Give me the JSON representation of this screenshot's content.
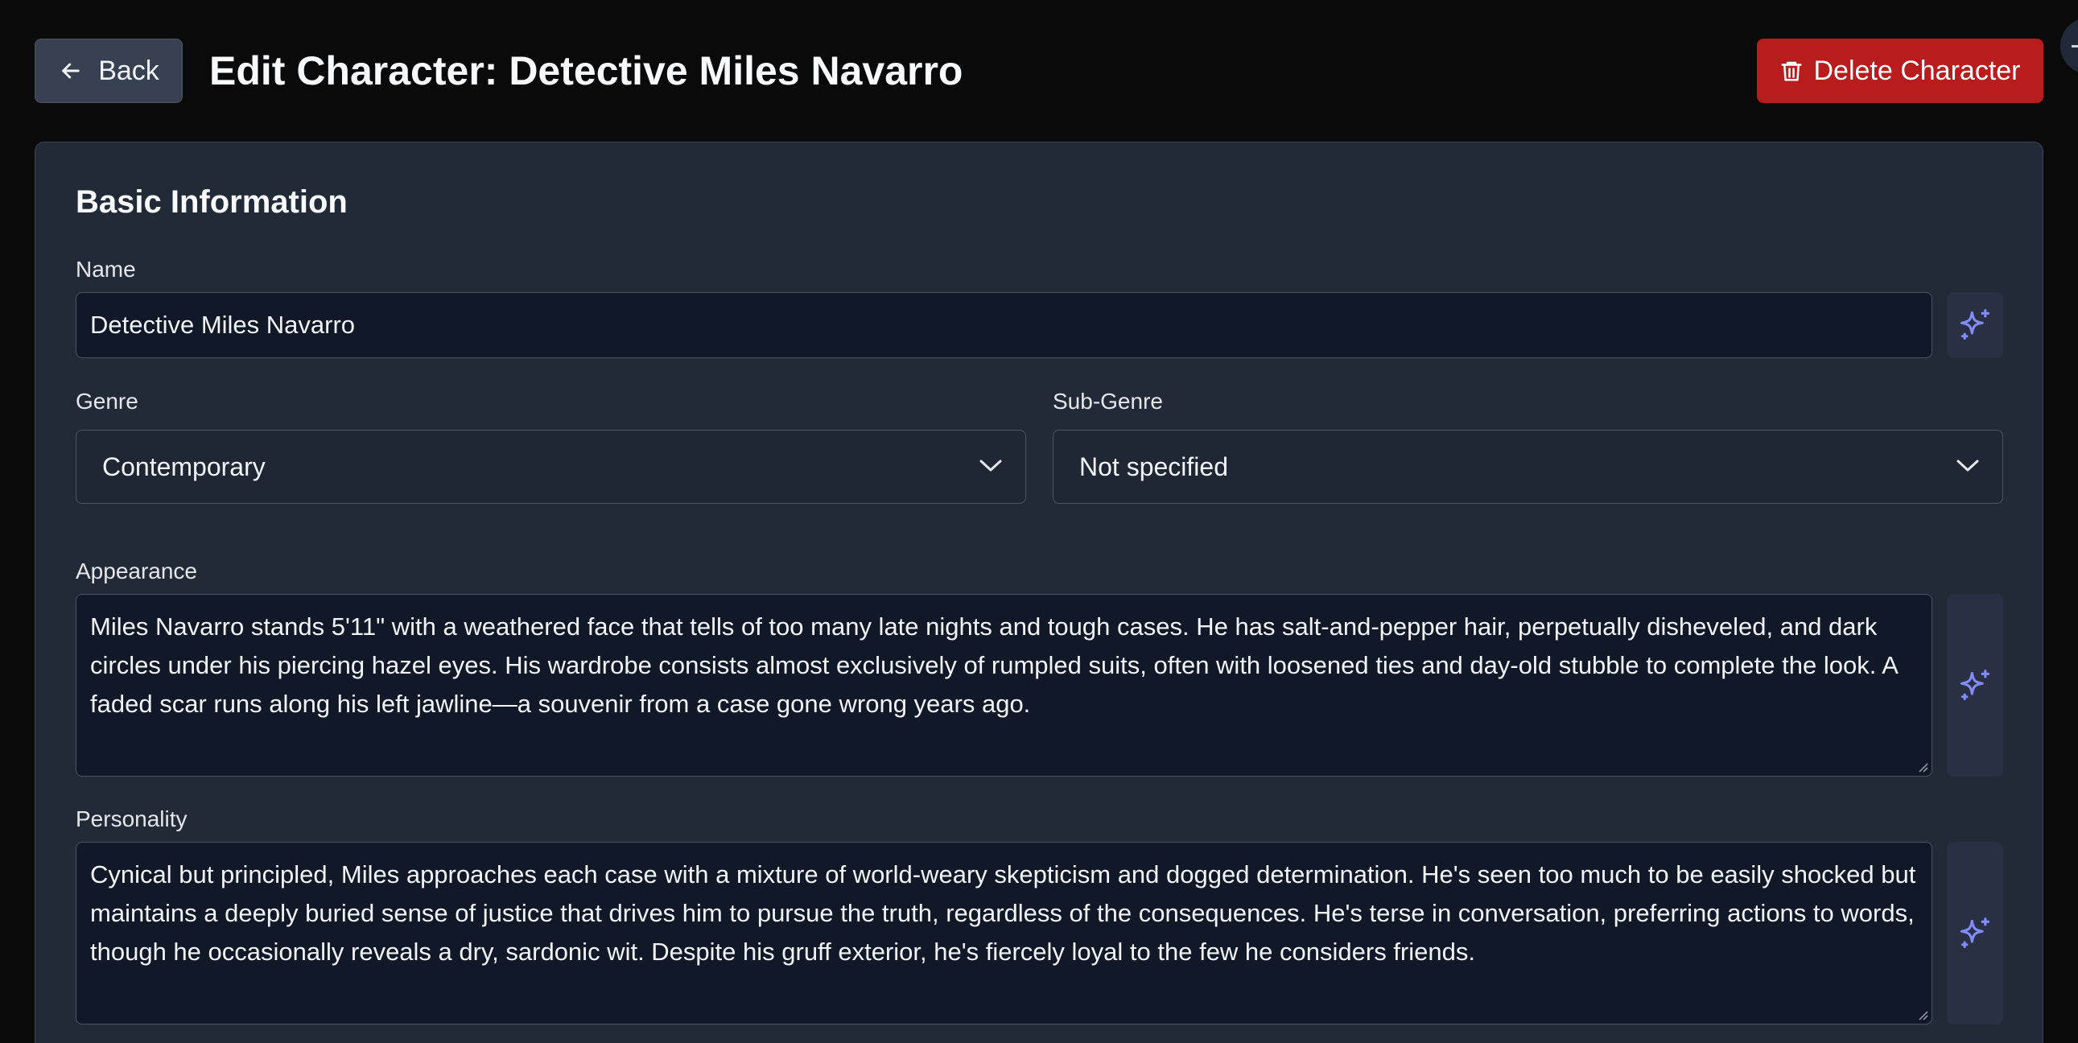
{
  "header": {
    "back_label": "Back",
    "title": "Edit Character: Detective Miles Navarro",
    "delete_label": "Delete Character"
  },
  "colors": {
    "accent": "#818cf8",
    "danger": "#b91c1c",
    "card_bg": "#222a38",
    "input_bg": "#111827"
  },
  "icons": {
    "back": "arrow-left-icon",
    "delete": "trash-icon",
    "generate": "sparkles-icon",
    "dropdown": "chevron-down-icon"
  },
  "basic_info": {
    "title": "Basic Information",
    "name": {
      "label": "Name",
      "value": "Detective Miles Navarro"
    },
    "genre": {
      "label": "Genre",
      "value": "Contemporary"
    },
    "sub_genre": {
      "label": "Sub-Genre",
      "value": "Not specified"
    },
    "appearance": {
      "label": "Appearance",
      "value": "Miles Navarro stands 5'11\" with a weathered face that tells of too many late nights and tough cases. He has salt-and-pepper hair, perpetually disheveled, and dark circles under his piercing hazel eyes. His wardrobe consists almost exclusively of rumpled suits, often with loosened ties and day-old stubble to complete the look. A faded scar runs along his left jawline—a souvenir from a case gone wrong years ago."
    },
    "personality": {
      "label": "Personality",
      "value": "Cynical but principled, Miles approaches each case with a mixture of world-weary skepticism and dogged determination. He's seen too much to be easily shocked but maintains a deeply buried sense of justice that drives him to pursue the truth, regardless of the consequences. He's terse in conversation, preferring actions to words, though he occasionally reveals a dry, sardonic wit. Despite his gruff exterior, he's fiercely loyal to the few he considers friends."
    }
  }
}
